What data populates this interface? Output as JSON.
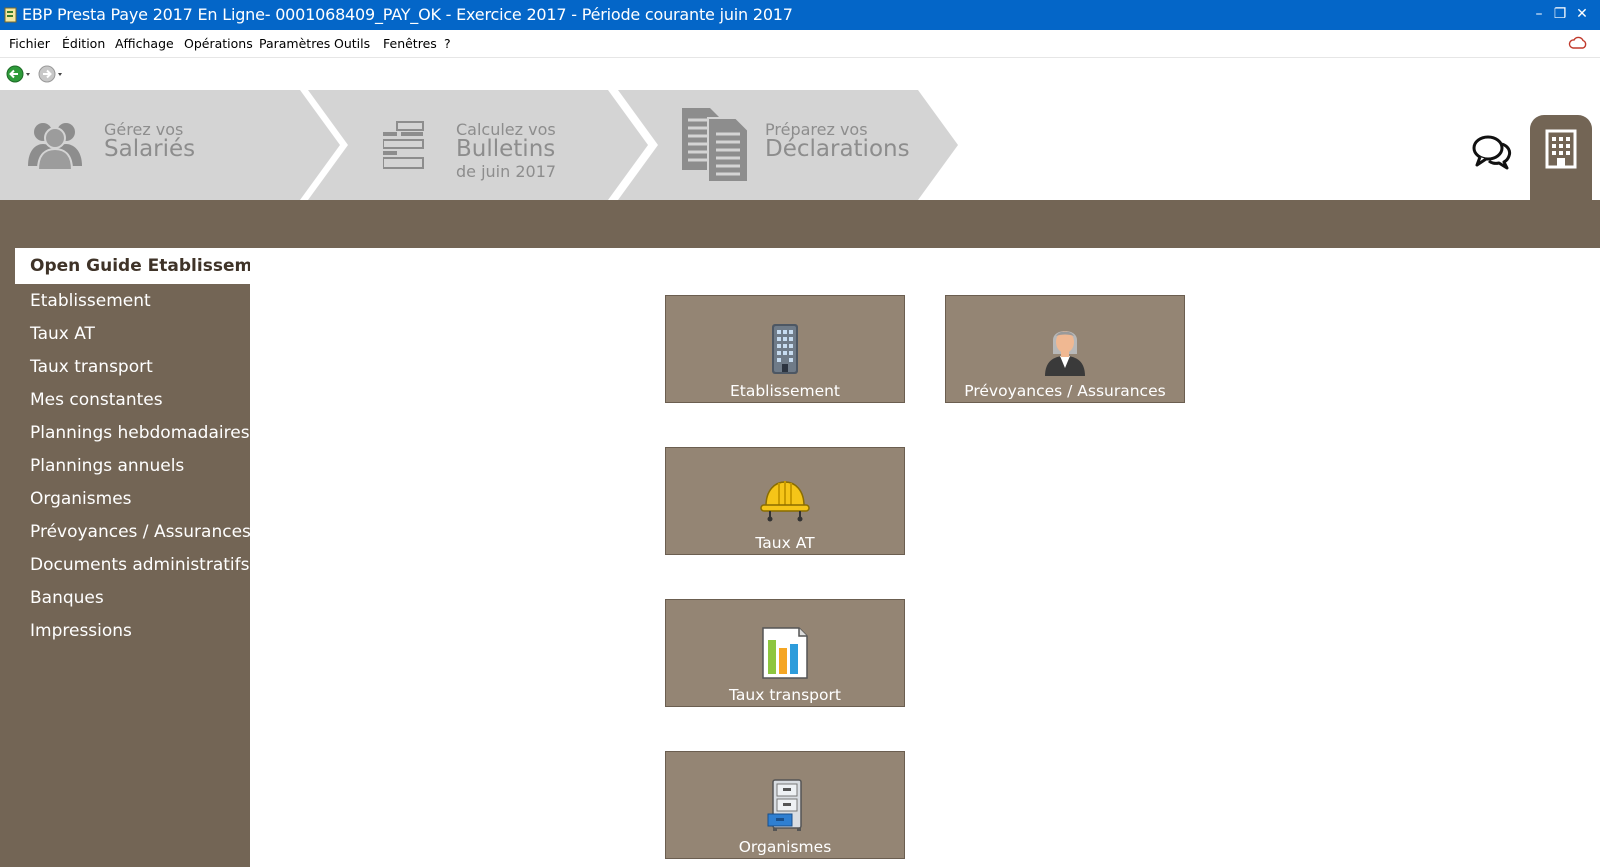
{
  "window": {
    "title": "EBP Presta Paye 2017 En Ligne- 0001068409_PAY_OK - Exercice 2017 - Période courante juin 2017",
    "minimize": "–",
    "restore": "❐",
    "close": "✕"
  },
  "menu": {
    "items": [
      "Fichier",
      "Édition",
      "Affichage",
      "Opérations",
      "Paramètres",
      "Outils",
      "Fenêtres",
      "?"
    ]
  },
  "workflow": {
    "step1": {
      "sub": "Gérez vos",
      "main": "Salariés"
    },
    "step2": {
      "sub": "Calculez vos",
      "main": "Bulletins",
      "small": "de juin 2017"
    },
    "step3": {
      "sub": "Préparez vos",
      "main": "Déclarations"
    }
  },
  "sidebar": {
    "active": "Open Guide Etablissement",
    "items": [
      "Etablissement",
      "Taux AT",
      "Taux transport",
      "Mes constantes",
      "Plannings hebdomadaires",
      "Plannings annuels",
      "Organismes",
      "Prévoyances / Assurances",
      "Documents administratifs",
      "Banques",
      "Impressions"
    ]
  },
  "tiles": {
    "etablissement": {
      "label": "Etablissement",
      "icon": "building-icon"
    },
    "prevoyances": {
      "label": "Prévoyances / Assurances",
      "icon": "person-icon"
    },
    "taux_at": {
      "label": "Taux AT",
      "icon": "helmet-icon"
    },
    "taux_transport": {
      "label": "Taux transport",
      "icon": "chart-document-icon"
    },
    "organismes": {
      "label": "Organismes",
      "icon": "file-cabinet-icon"
    }
  },
  "colors": {
    "titlebar": "#0466c8",
    "brown": "#736555",
    "tile": "#948574",
    "step_bg": "#d4d4d4",
    "step_text": "#8d8d8d"
  }
}
